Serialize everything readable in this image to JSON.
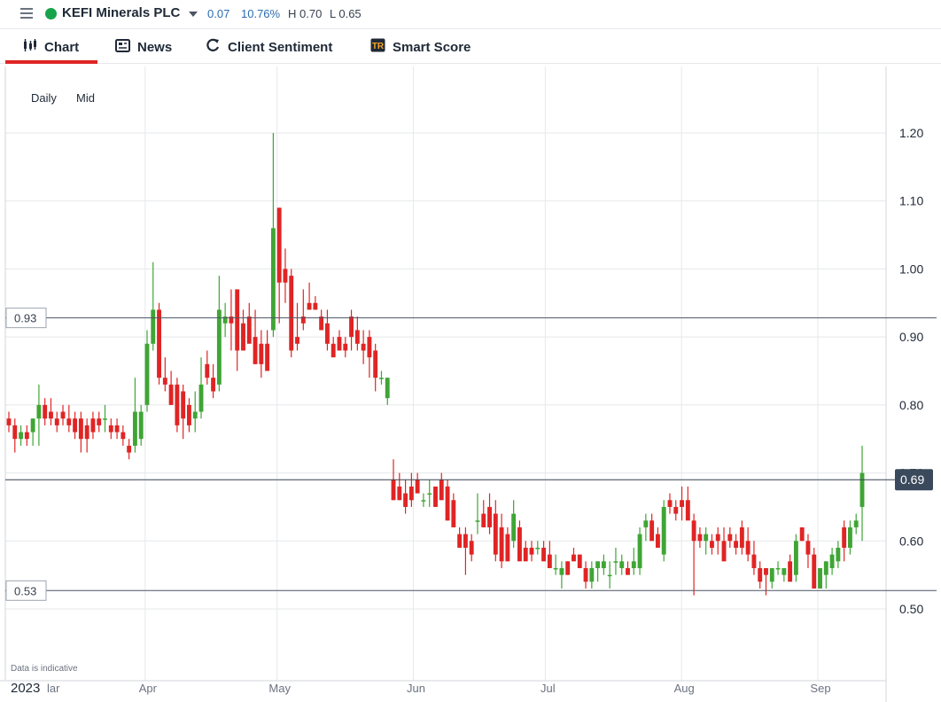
{
  "header": {
    "title": "KEFI Minerals PLC",
    "change": "0.07",
    "change_pct": "10.76%",
    "high": "H 0.70",
    "low": "L 0.65",
    "status_color": "#16a34a",
    "accent_color": "#2b6cb0"
  },
  "tabs": [
    {
      "label": "Chart",
      "icon": "candlestick-icon",
      "active": true
    },
    {
      "label": "News",
      "icon": "newspaper-icon",
      "active": false
    },
    {
      "label": "Client Sentiment",
      "icon": "refresh-icon",
      "active": false
    },
    {
      "label": "Smart Score",
      "icon": "tipranks-icon",
      "active": false
    }
  ],
  "controls": {
    "interval": "Daily",
    "price_type": "Mid"
  },
  "disclaimer": "Data is indicative",
  "chart_data": {
    "type": "candlestick",
    "up_color": "#3fa535",
    "down_color": "#e02424",
    "ylim": [
      0.47,
      1.245
    ],
    "y_ticks": [
      "0.50",
      "0.60",
      "0.70",
      "0.80",
      "0.90",
      "1.00",
      "1.10",
      "1.20"
    ],
    "x_ticks": [
      {
        "label": "2023",
        "date": "2023-03-01"
      },
      {
        "label": "lar",
        "date": "2023-03-04"
      },
      {
        "label": "Apr",
        "date": "2023-04-01"
      },
      {
        "label": "May",
        "date": "2023-05-01"
      },
      {
        "label": "Jun",
        "date": "2023-06-01"
      },
      {
        "label": "Jul",
        "date": "2023-07-01"
      },
      {
        "label": "Aug",
        "date": "2023-08-01"
      },
      {
        "label": "Sep",
        "date": "2023-09-01"
      }
    ],
    "reference_lines": [
      {
        "label": "0.93",
        "value": 0.928
      },
      {
        "label": "0.53",
        "value": 0.527
      }
    ],
    "last_price": {
      "label": "0.69",
      "value": 0.69
    },
    "candles_ohlc": [
      [
        0.78,
        0.79,
        0.76,
        0.77
      ],
      [
        0.77,
        0.78,
        0.73,
        0.75
      ],
      [
        0.75,
        0.77,
        0.74,
        0.76
      ],
      [
        0.76,
        0.77,
        0.74,
        0.75
      ],
      [
        0.76,
        0.78,
        0.74,
        0.78
      ],
      [
        0.78,
        0.83,
        0.74,
        0.8
      ],
      [
        0.8,
        0.81,
        0.77,
        0.78
      ],
      [
        0.79,
        0.81,
        0.77,
        0.78
      ],
      [
        0.78,
        0.79,
        0.76,
        0.77
      ],
      [
        0.79,
        0.8,
        0.77,
        0.78
      ],
      [
        0.78,
        0.8,
        0.76,
        0.77
      ],
      [
        0.78,
        0.79,
        0.75,
        0.76
      ],
      [
        0.78,
        0.79,
        0.73,
        0.75
      ],
      [
        0.77,
        0.78,
        0.73,
        0.75
      ],
      [
        0.78,
        0.79,
        0.75,
        0.76
      ],
      [
        0.78,
        0.79,
        0.76,
        0.77
      ],
      [
        0.78,
        0.8,
        0.76,
        0.78
      ],
      [
        0.77,
        0.78,
        0.75,
        0.76
      ],
      [
        0.77,
        0.78,
        0.75,
        0.76
      ],
      [
        0.76,
        0.77,
        0.74,
        0.75
      ],
      [
        0.74,
        0.75,
        0.72,
        0.73
      ],
      [
        0.74,
        0.84,
        0.73,
        0.79
      ],
      [
        0.75,
        0.8,
        0.74,
        0.79
      ],
      [
        0.8,
        0.91,
        0.79,
        0.89
      ],
      [
        0.89,
        1.01,
        0.88,
        0.94
      ],
      [
        0.94,
        0.95,
        0.83,
        0.84
      ],
      [
        0.84,
        0.87,
        0.82,
        0.83
      ],
      [
        0.83,
        0.85,
        0.8,
        0.8
      ],
      [
        0.83,
        0.84,
        0.76,
        0.77
      ],
      [
        0.82,
        0.83,
        0.75,
        0.78
      ],
      [
        0.8,
        0.81,
        0.76,
        0.77
      ],
      [
        0.78,
        0.82,
        0.76,
        0.79
      ],
      [
        0.79,
        0.87,
        0.78,
        0.83
      ],
      [
        0.86,
        0.88,
        0.83,
        0.84
      ],
      [
        0.84,
        0.86,
        0.81,
        0.82
      ],
      [
        0.83,
        0.99,
        0.82,
        0.94
      ],
      [
        0.92,
        0.95,
        0.9,
        0.93
      ],
      [
        0.93,
        0.97,
        0.88,
        0.92
      ],
      [
        0.97,
        0.97,
        0.85,
        0.88
      ],
      [
        0.92,
        0.94,
        0.88,
        0.88
      ],
      [
        0.93,
        0.95,
        0.9,
        0.89
      ],
      [
        0.9,
        0.94,
        0.86,
        0.86
      ],
      [
        0.89,
        0.91,
        0.84,
        0.86
      ],
      [
        0.89,
        0.91,
        0.85,
        0.85
      ],
      [
        0.91,
        1.2,
        0.9,
        1.06
      ],
      [
        1.09,
        1.09,
        0.92,
        0.98
      ],
      [
        1.0,
        1.03,
        0.95,
        0.98
      ],
      [
        0.99,
        1.0,
        0.87,
        0.88
      ],
      [
        0.9,
        0.95,
        0.88,
        0.89
      ],
      [
        0.93,
        0.97,
        0.91,
        0.92
      ],
      [
        0.95,
        0.98,
        0.94,
        0.94
      ],
      [
        0.95,
        0.96,
        0.94,
        0.94
      ],
      [
        0.93,
        0.94,
        0.91,
        0.91
      ],
      [
        0.92,
        0.94,
        0.88,
        0.89
      ],
      [
        0.89,
        0.9,
        0.87,
        0.87
      ],
      [
        0.9,
        0.91,
        0.88,
        0.88
      ],
      [
        0.89,
        0.9,
        0.87,
        0.88
      ],
      [
        0.93,
        0.94,
        0.88,
        0.9
      ],
      [
        0.91,
        0.93,
        0.88,
        0.89
      ],
      [
        0.89,
        0.91,
        0.86,
        0.88
      ],
      [
        0.9,
        0.91,
        0.84,
        0.87
      ],
      [
        0.88,
        0.89,
        0.82,
        0.84
      ],
      [
        0.84,
        0.85,
        0.83,
        0.84
      ],
      [
        0.81,
        0.84,
        0.8,
        0.84
      ],
      [
        0.69,
        0.72,
        0.66,
        0.66
      ],
      [
        0.68,
        0.7,
        0.66,
        0.66
      ],
      [
        0.67,
        0.69,
        0.64,
        0.65
      ],
      [
        0.68,
        0.7,
        0.65,
        0.66
      ],
      [
        0.69,
        0.7,
        0.67,
        0.67
      ],
      [
        0.66,
        0.67,
        0.65,
        0.66
      ],
      [
        0.67,
        0.69,
        0.65,
        0.67
      ],
      [
        0.68,
        0.68,
        0.66,
        0.65
      ],
      [
        0.69,
        0.7,
        0.66,
        0.66
      ],
      [
        0.68,
        0.69,
        0.63,
        0.63
      ],
      [
        0.66,
        0.67,
        0.62,
        0.62
      ],
      [
        0.61,
        0.62,
        0.59,
        0.59
      ],
      [
        0.61,
        0.62,
        0.55,
        0.59
      ],
      [
        0.6,
        0.61,
        0.57,
        0.58
      ],
      [
        0.63,
        0.67,
        0.61,
        0.63
      ],
      [
        0.64,
        0.66,
        0.62,
        0.62
      ],
      [
        0.65,
        0.67,
        0.61,
        0.62
      ],
      [
        0.64,
        0.66,
        0.57,
        0.58
      ],
      [
        0.62,
        0.64,
        0.56,
        0.57
      ],
      [
        0.61,
        0.62,
        0.57,
        0.57
      ],
      [
        0.6,
        0.66,
        0.59,
        0.64
      ],
      [
        0.62,
        0.63,
        0.57,
        0.57
      ],
      [
        0.59,
        0.6,
        0.57,
        0.57
      ],
      [
        0.59,
        0.6,
        0.57,
        0.58
      ],
      [
        0.59,
        0.6,
        0.58,
        0.59
      ],
      [
        0.59,
        0.6,
        0.57,
        0.57
      ],
      [
        0.58,
        0.6,
        0.56,
        0.56
      ],
      [
        0.56,
        0.58,
        0.55,
        0.56
      ],
      [
        0.55,
        0.57,
        0.53,
        0.56
      ],
      [
        0.57,
        0.57,
        0.55,
        0.55
      ],
      [
        0.58,
        0.59,
        0.57,
        0.57
      ],
      [
        0.58,
        0.58,
        0.56,
        0.56
      ],
      [
        0.56,
        0.57,
        0.53,
        0.54
      ],
      [
        0.54,
        0.57,
        0.53,
        0.56
      ],
      [
        0.56,
        0.57,
        0.54,
        0.57
      ],
      [
        0.56,
        0.58,
        0.55,
        0.57
      ],
      [
        0.55,
        0.57,
        0.53,
        0.55
      ],
      [
        0.57,
        0.59,
        0.55,
        0.57
      ],
      [
        0.56,
        0.58,
        0.55,
        0.57
      ],
      [
        0.56,
        0.57,
        0.55,
        0.55
      ],
      [
        0.56,
        0.59,
        0.55,
        0.57
      ],
      [
        0.56,
        0.62,
        0.55,
        0.61
      ],
      [
        0.62,
        0.64,
        0.6,
        0.63
      ],
      [
        0.63,
        0.64,
        0.6,
        0.6
      ],
      [
        0.61,
        0.62,
        0.59,
        0.59
      ],
      [
        0.58,
        0.66,
        0.57,
        0.65
      ],
      [
        0.66,
        0.67,
        0.64,
        0.65
      ],
      [
        0.65,
        0.66,
        0.63,
        0.64
      ],
      [
        0.66,
        0.68,
        0.63,
        0.65
      ],
      [
        0.66,
        0.68,
        0.64,
        0.63
      ],
      [
        0.63,
        0.64,
        0.52,
        0.6
      ],
      [
        0.61,
        0.62,
        0.59,
        0.6
      ],
      [
        0.6,
        0.62,
        0.58,
        0.61
      ],
      [
        0.6,
        0.61,
        0.58,
        0.59
      ],
      [
        0.61,
        0.62,
        0.58,
        0.6
      ],
      [
        0.6,
        0.62,
        0.57,
        0.57
      ],
      [
        0.61,
        0.62,
        0.59,
        0.6
      ],
      [
        0.6,
        0.61,
        0.58,
        0.59
      ],
      [
        0.62,
        0.63,
        0.58,
        0.59
      ],
      [
        0.6,
        0.62,
        0.57,
        0.58
      ],
      [
        0.58,
        0.6,
        0.55,
        0.56
      ],
      [
        0.56,
        0.57,
        0.53,
        0.54
      ],
      [
        0.56,
        0.56,
        0.52,
        0.55
      ],
      [
        0.54,
        0.56,
        0.53,
        0.56
      ],
      [
        0.56,
        0.57,
        0.55,
        0.56
      ],
      [
        0.55,
        0.56,
        0.54,
        0.56
      ],
      [
        0.57,
        0.58,
        0.55,
        0.54
      ],
      [
        0.55,
        0.61,
        0.54,
        0.6
      ],
      [
        0.62,
        0.62,
        0.6,
        0.6
      ],
      [
        0.6,
        0.61,
        0.56,
        0.58
      ],
      [
        0.58,
        0.59,
        0.54,
        0.53
      ],
      [
        0.53,
        0.56,
        0.53,
        0.56
      ],
      [
        0.55,
        0.57,
        0.53,
        0.57
      ],
      [
        0.56,
        0.59,
        0.55,
        0.58
      ],
      [
        0.57,
        0.6,
        0.56,
        0.59
      ],
      [
        0.62,
        0.63,
        0.57,
        0.59
      ],
      [
        0.59,
        0.63,
        0.58,
        0.62
      ],
      [
        0.62,
        0.64,
        0.61,
        0.63
      ],
      [
        0.65,
        0.74,
        0.6,
        0.7
      ]
    ]
  }
}
